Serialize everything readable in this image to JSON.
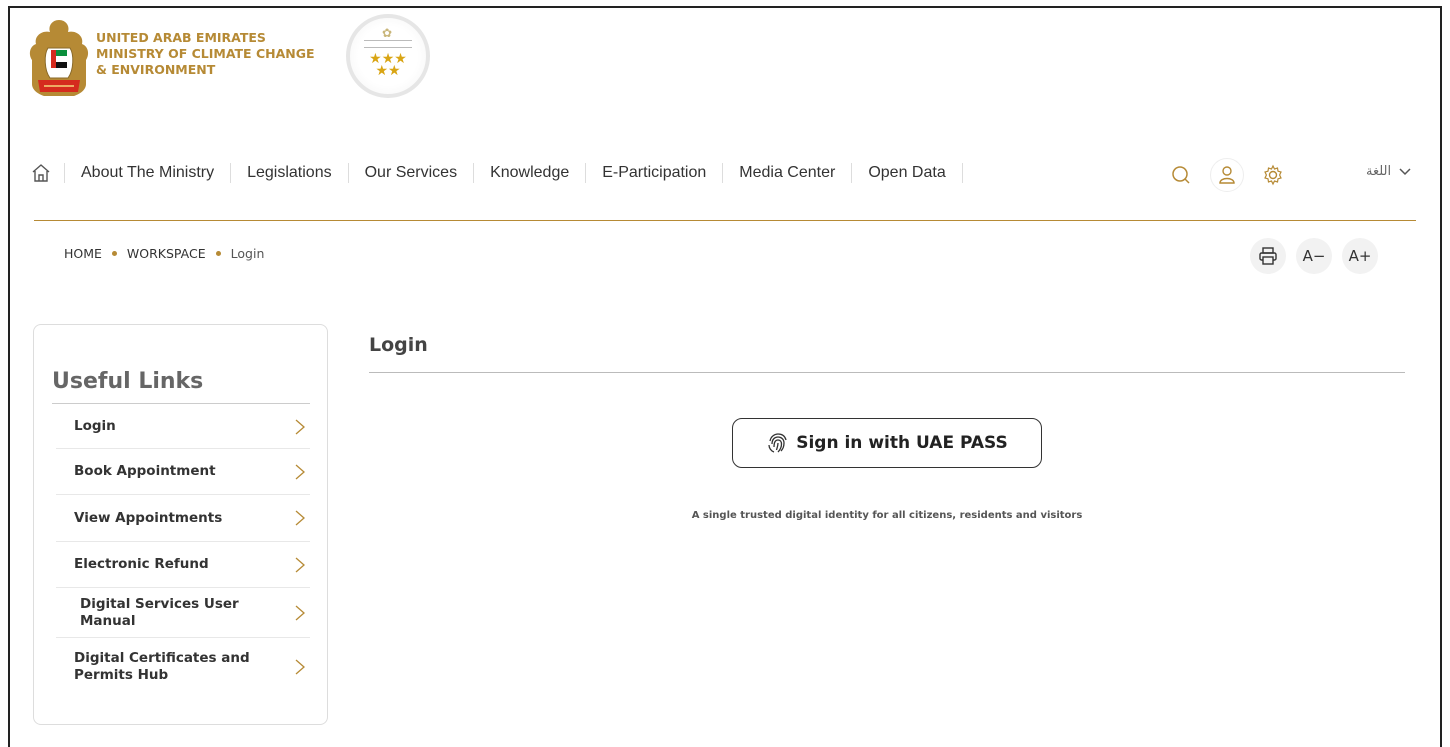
{
  "header": {
    "ministry_line1": "UNITED ARAB EMIRATES",
    "ministry_line2": "MINISTRY OF CLIMATE CHANGE",
    "ministry_line3": "& ENVIRONMENT",
    "emblem_icon": "uae-emblem-icon",
    "seal_icon": "government-excellence-seal-icon"
  },
  "nav": {
    "home_icon": "home-icon",
    "items": [
      {
        "label": "About The Ministry"
      },
      {
        "label": "Legislations"
      },
      {
        "label": "Our Services"
      },
      {
        "label": "Knowledge"
      },
      {
        "label": "E-Participation"
      },
      {
        "label": "Media Center"
      },
      {
        "label": "Open Data"
      }
    ],
    "language_label": "اللغة",
    "accent_color": "#b68a35"
  },
  "breadcrumb": {
    "items": [
      "HOME",
      "WORKSPACE",
      "Login"
    ]
  },
  "accessibility": {
    "decrease_label": "A−",
    "increase_label": "A+"
  },
  "sidebar": {
    "title": "Useful Links",
    "links": [
      {
        "label": "Login"
      },
      {
        "label": "Book Appointment"
      },
      {
        "label": "View Appointments"
      },
      {
        "label": "Electronic Refund"
      },
      {
        "label": "Digital Services User Manual"
      },
      {
        "label": "Digital Certificates and Permits Hub"
      }
    ]
  },
  "main": {
    "title": "Login",
    "uaepass_label": "Sign in with UAE PASS",
    "tagline": "A single trusted digital identity for all citizens, residents and visitors"
  }
}
